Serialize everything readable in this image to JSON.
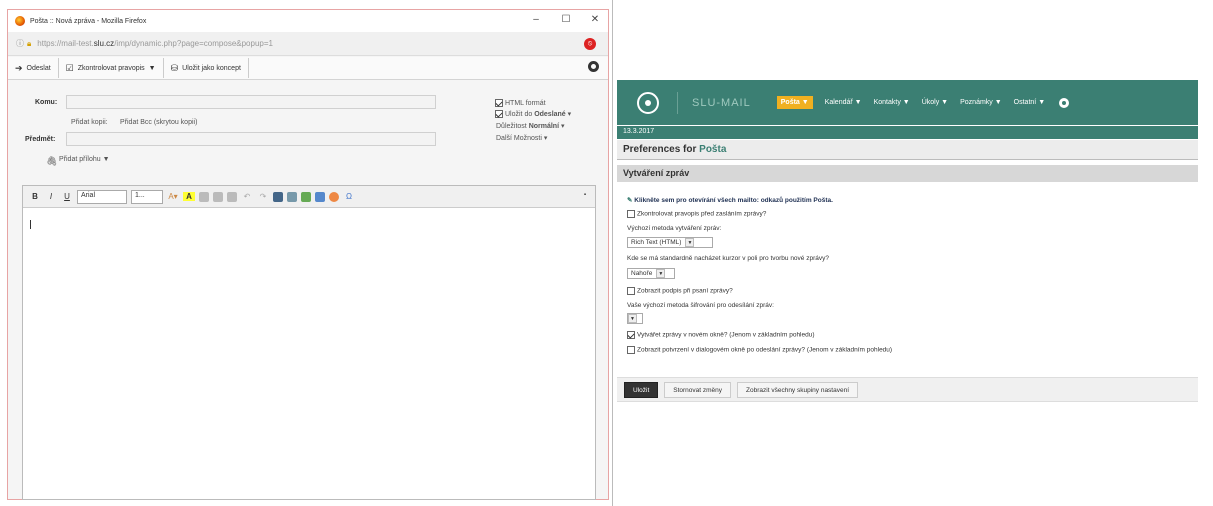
{
  "popup": {
    "window_title": "Pošta :: Nová zpráva - Mozilla Firefox",
    "win_minimize": "–",
    "win_maximize": "☐",
    "win_close": "✕",
    "url_prefix": "https://mail-test.",
    "url_domain": "slu.cz",
    "url_suffix": "/imp/dynamic.php?page=compose&popup=1",
    "toolbar": {
      "send_label": "Odeslat",
      "spellcheck_label": "Zkontrolovat pravopis",
      "save_draft_label": "Uložit jako koncept"
    },
    "form": {
      "to_label": "Komu:",
      "add_cc": "Přidat kopii:",
      "add_bcc": "Přidat Bcc (skrytou kopii)",
      "subject_label": "Předmět:",
      "attach_label": "Přidat přílohu",
      "html_format": "HTML formát",
      "save_to_prefix": "Uložit do",
      "save_to_folder": "Odeslané",
      "priority_prefix": "Důležitost",
      "priority_value": "Normální",
      "more_options": "Další Možnosti"
    },
    "editor": {
      "bold": "B",
      "italic": "I",
      "underline": "U",
      "font_name": "Arial",
      "font_size": "1..."
    }
  },
  "prefs": {
    "app_name": "SLU-MAIL",
    "menu": [
      "Pošta",
      "Kalendář",
      "Kontakty",
      "Úkoly",
      "Poznámky",
      "Ostatní"
    ],
    "active_menu_index": 0,
    "date": "13.3.2017",
    "title_prefix": "Preferences for",
    "title_app": "Pošta",
    "section_title": "Vytváření zpráv",
    "link_text": "Klikněte sem pro otevírání všech mailto: odkazů použitím Pošta.",
    "opt_spellcheck": "Zkontrolovat pravopis před zasláním zprávy?",
    "default_compose_label": "Výchozí metoda vytváření zpráv:",
    "default_compose_value": "Rich Text (HTML)",
    "cursor_label": "Kde se má standardně nacházet kurzor v poli pro tvorbu nové zprávy?",
    "cursor_value": "Nahoře",
    "opt_signature": "Zobrazit podpis při psaní zprávy?",
    "filter_label": "Vaše výchozí metoda šifrování pro odesílání zpráv:",
    "opt_new_window": "Vytvářet zprávy v novém okně? (Jenom v základním pohledu)",
    "opt_confirm": "Zobrazit potvrzení v dialogovém okně po odeslání zprávy? (Jenom v základním pohledu)",
    "btn_save": "Uložit",
    "btn_undo": "Stornovat změny",
    "btn_show_all": "Zobrazit všechny skupiny nastavení"
  },
  "colors": {
    "header_green": "#3b7f73",
    "active_menu": "#f0b020",
    "popup_border": "#e7a4a4"
  }
}
